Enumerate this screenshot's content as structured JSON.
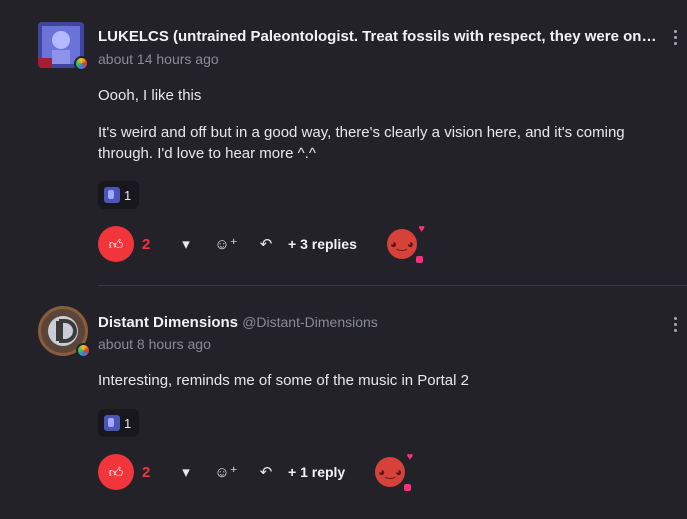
{
  "comments": [
    {
      "author": "LUKELCS (untrained Paleontologist. Treat fossils with respect, they were once...",
      "handle": "",
      "time": "about 14 hours ago",
      "paragraphs": [
        "Oooh, I like this",
        "It's weird and off but in a good way, there's clearly a vision here, and it's coming through.  I'd love to hear more ^.^"
      ],
      "reaction_count": "1",
      "likes": "2",
      "replies_label": "+ 3 replies"
    },
    {
      "author": "Distant Dimensions",
      "handle": "@Distant-Dimensions",
      "time": "about 8 hours ago",
      "paragraphs": [
        "Interesting, reminds me of some of the music in Portal 2"
      ],
      "reaction_count": "1",
      "likes": "2",
      "replies_label": "+ 1 reply"
    }
  ],
  "icons": {
    "like": "thumbs-up-icon",
    "dislike": "thumbs-down-icon",
    "add_reaction": "add-emoji-icon",
    "reply": "reply-arrow-icon",
    "more": "kebab-menu-icon"
  },
  "colors": {
    "accent": "#f2343b",
    "background": "#232229"
  }
}
